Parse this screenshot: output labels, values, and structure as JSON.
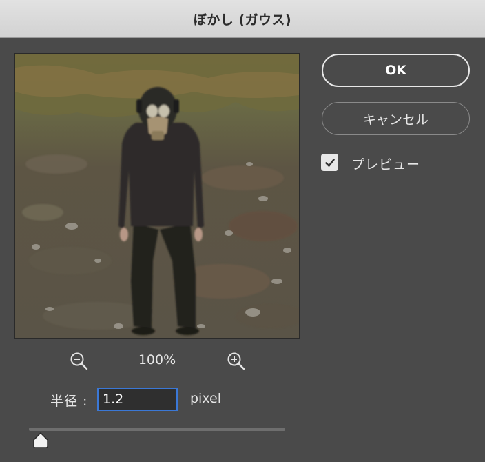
{
  "window": {
    "title": "ぼかし (ガウス)"
  },
  "preview": {
    "image_alt": "person in black hoodie and gas mask standing on rocky ground",
    "zoom_out_icon": "zoom-out-magnifier-icon",
    "zoom_level": "100%",
    "zoom_in_icon": "zoom-in-magnifier-icon"
  },
  "radius": {
    "label": "半径 :",
    "value": "1.2",
    "unit": "pixel",
    "slider_fraction": 0.03
  },
  "buttons": {
    "ok_label": "OK",
    "cancel_label": "キャンセル"
  },
  "preview_toggle": {
    "label": "プレビュー",
    "checked": true
  },
  "colors": {
    "dialog_bg": "#4a4a4a",
    "titlebar_bg": "#d8d8d8",
    "focus_accent": "#3b78d6"
  }
}
